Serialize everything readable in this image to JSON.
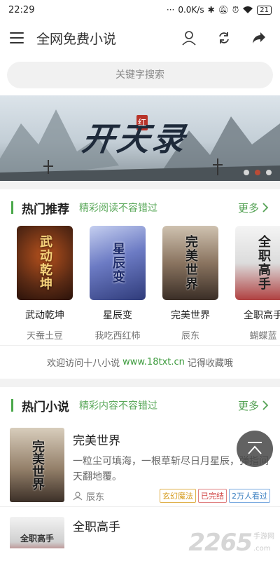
{
  "status": {
    "time": "22:29",
    "speed": "0.0K/s",
    "battery": "21"
  },
  "appbar": {
    "title": "全网免费小说"
  },
  "search": {
    "placeholder": "关键字搜索"
  },
  "banner": {
    "title_text": "开天录",
    "badge": "红",
    "page_count": 3,
    "active_index": 1
  },
  "hot_recommend": {
    "title": "热门推荐",
    "subtitle": "精彩阅读不容错过",
    "more": "更多",
    "books": [
      {
        "name": "武动乾坤",
        "author": "天蚕土豆",
        "cover_text": "武动乾坤",
        "cover_color": "#5a2a14"
      },
      {
        "name": "星辰变",
        "author": "我吃西红柿",
        "cover_text": "星辰变",
        "cover_color": "#3d4b8c"
      },
      {
        "name": "完美世界",
        "author": "辰东",
        "cover_text": "完美世界",
        "cover_color": "#6b5a4a"
      },
      {
        "name": "全职高手",
        "author": "蝴蝶蓝",
        "cover_text": "全职高手",
        "cover_color": "#c8c8c8"
      }
    ]
  },
  "welcome": {
    "prefix": "欢迎访问十八小说",
    "site": "www.18txt.cn",
    "suffix": "记得收藏哦"
  },
  "hot_novels": {
    "title": "热门小说",
    "subtitle": "精彩内容不容错过",
    "more": "更多",
    "items": [
      {
        "title": "完美世界",
        "desc": "一粒尘可填海，一根草斩尽日月星辰，弹指间天翻地覆。",
        "author": "辰东",
        "tags": [
          "玄幻魔法",
          "已完结",
          "2万人看过"
        ],
        "cover_text": "完美世界"
      },
      {
        "title": "全职高手",
        "cover_text": "全职高手"
      }
    ]
  },
  "watermark": {
    "number": "2265",
    "suffix": ".com",
    "sub": "手游网"
  },
  "colors": {
    "accent": "#4aa84a",
    "banner_active_dot": "#c74a33"
  }
}
